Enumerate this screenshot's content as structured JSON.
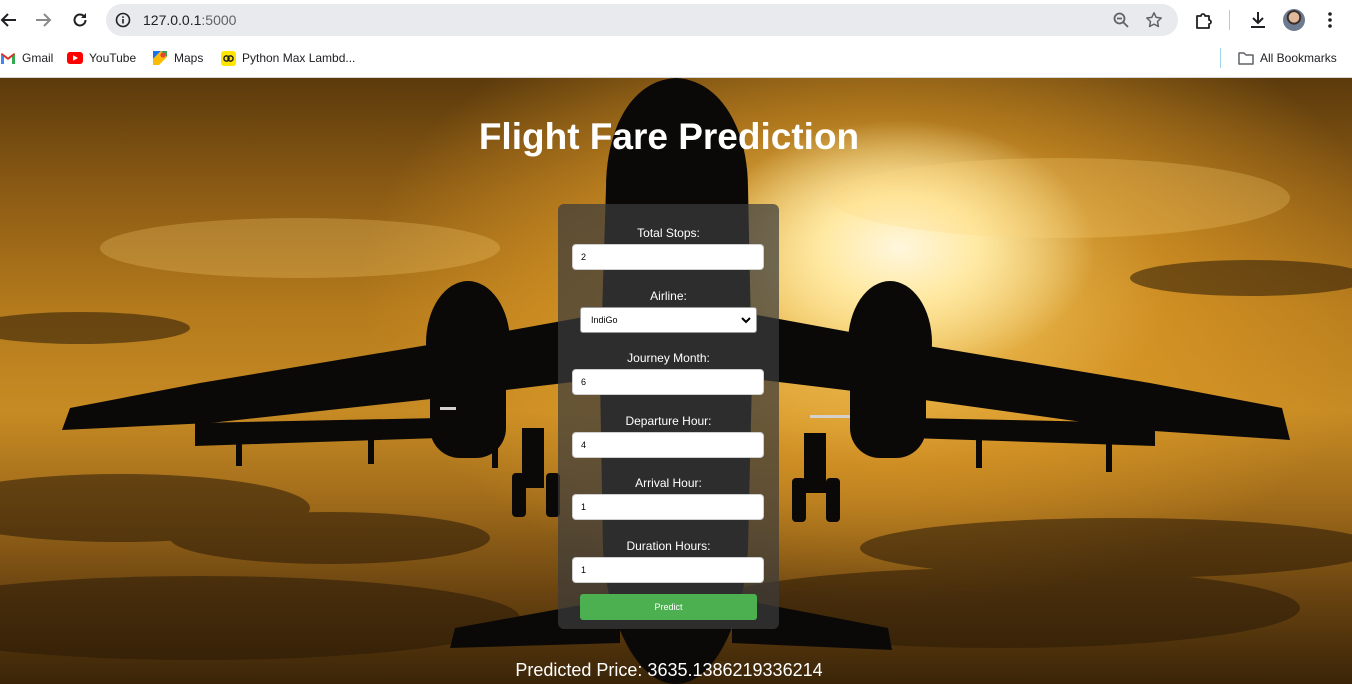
{
  "browser": {
    "url_host": "127.0.0.1",
    "url_port": ":5000",
    "bookmarks": [
      {
        "label": "Gmail",
        "icon": "gmail-icon"
      },
      {
        "label": "YouTube",
        "icon": "youtube-icon"
      },
      {
        "label": "Maps",
        "icon": "maps-icon"
      },
      {
        "label": "Python Max Lambd...",
        "icon": "python-max-icon"
      }
    ],
    "all_bookmarks_label": "All Bookmarks"
  },
  "page": {
    "title": "Flight Fare Prediction",
    "form": {
      "total_stops": {
        "label": "Total Stops:",
        "value": "2"
      },
      "airline": {
        "label": "Airline:",
        "value": "IndiGo"
      },
      "journey_month": {
        "label": "Journey Month:",
        "value": "6"
      },
      "departure_hour": {
        "label": "Departure Hour:",
        "value": "4"
      },
      "arrival_hour": {
        "label": "Arrival Hour:",
        "value": "1"
      },
      "duration_hours": {
        "label": "Duration Hours:",
        "value": "1"
      },
      "predict_label": "Predict"
    },
    "result": "Predicted Price: 3635.1386219336214"
  },
  "colors": {
    "predict_button": "#4caf50",
    "form_background": "rgba(60,60,60,0.72)"
  }
}
